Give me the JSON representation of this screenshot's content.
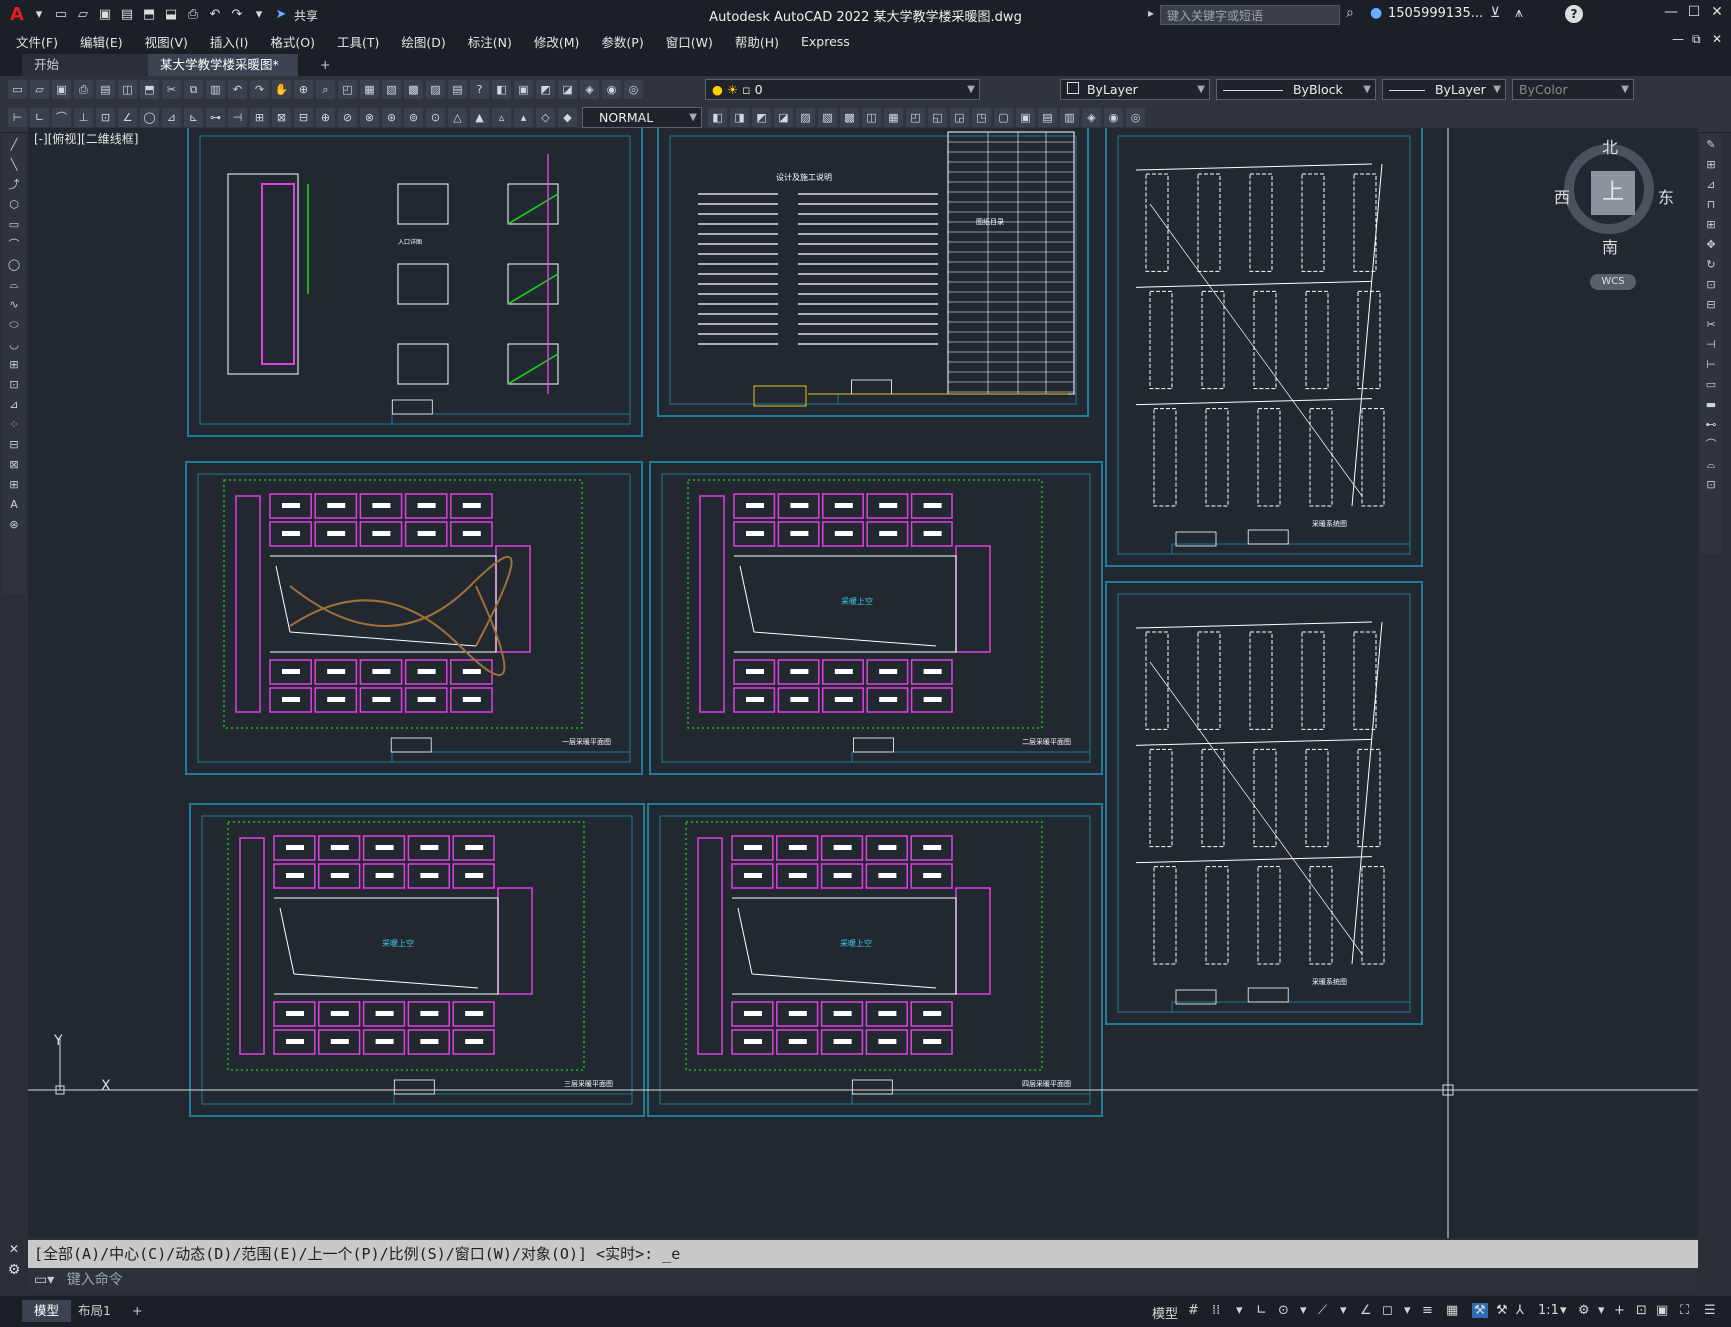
{
  "app": {
    "title": "Autodesk AutoCAD 2022    某大学教学楼采暖图.dwg",
    "share_label": "共享",
    "search_placeholder": "键入关键字或短语",
    "user_label": "1505999135...",
    "help_icon": "?"
  },
  "menu": [
    "文件(F)",
    "编辑(E)",
    "视图(V)",
    "插入(I)",
    "格式(O)",
    "工具(T)",
    "绘图(D)",
    "标注(N)",
    "修改(M)",
    "参数(P)",
    "窗口(W)",
    "帮助(H)",
    "Express"
  ],
  "tabs": {
    "start": "开始",
    "drawing": "某大学教学楼采暖图*",
    "add": "+"
  },
  "toolbar1": {
    "layer_value": "0",
    "color_value": "ByLayer",
    "linetype_value": "ByBlock",
    "lineweight_value": "ByLayer",
    "plotstyle_value": "ByColor"
  },
  "toolbar2": {
    "dimstyle_value": "NORMAL"
  },
  "viewport": {
    "label": "[-][俯视][二维线框]"
  },
  "viewcube": {
    "north": "北",
    "south": "南",
    "east": "东",
    "west": "西",
    "top": "上",
    "wcs": "WCS"
  },
  "ucs": {
    "x": "X",
    "y": "Y"
  },
  "sheets": [
    {
      "id": "s1",
      "title": "入口详图"
    },
    {
      "id": "s2",
      "title": "设计及施工说明",
      "subtitle": "图纸目录"
    },
    {
      "id": "s3",
      "title": "采暖系统图"
    },
    {
      "id": "s4",
      "title": "一层采暖平面图",
      "center": ""
    },
    {
      "id": "s5",
      "title": "二层采暖平面图",
      "center": "采暖上空"
    },
    {
      "id": "s6",
      "title": "三层采暖平面图",
      "center": "采暖上空"
    },
    {
      "id": "s7",
      "title": "四层采暖平面图",
      "center": "采暖上空"
    },
    {
      "id": "s8",
      "title": "采暖系统图"
    }
  ],
  "command": {
    "history": "[全部(A)/中心(C)/动态(D)/范围(E)/上一个(P)/比例(S)/窗口(W)/对象(O)] <实时>: _e",
    "placeholder": "键入命令"
  },
  "statusbar": {
    "model_tab": "模型",
    "layout_tab": "布局1",
    "add_tab": "+",
    "model_label": "模型",
    "scale": "1:1"
  },
  "colors": {
    "magenta": "#e040e0",
    "green": "#22d822",
    "cyan": "#2aa8c8",
    "white": "#ffffff",
    "yellow": "#e8c020",
    "brown": "#a0703a",
    "frame": "#1f7a96"
  }
}
